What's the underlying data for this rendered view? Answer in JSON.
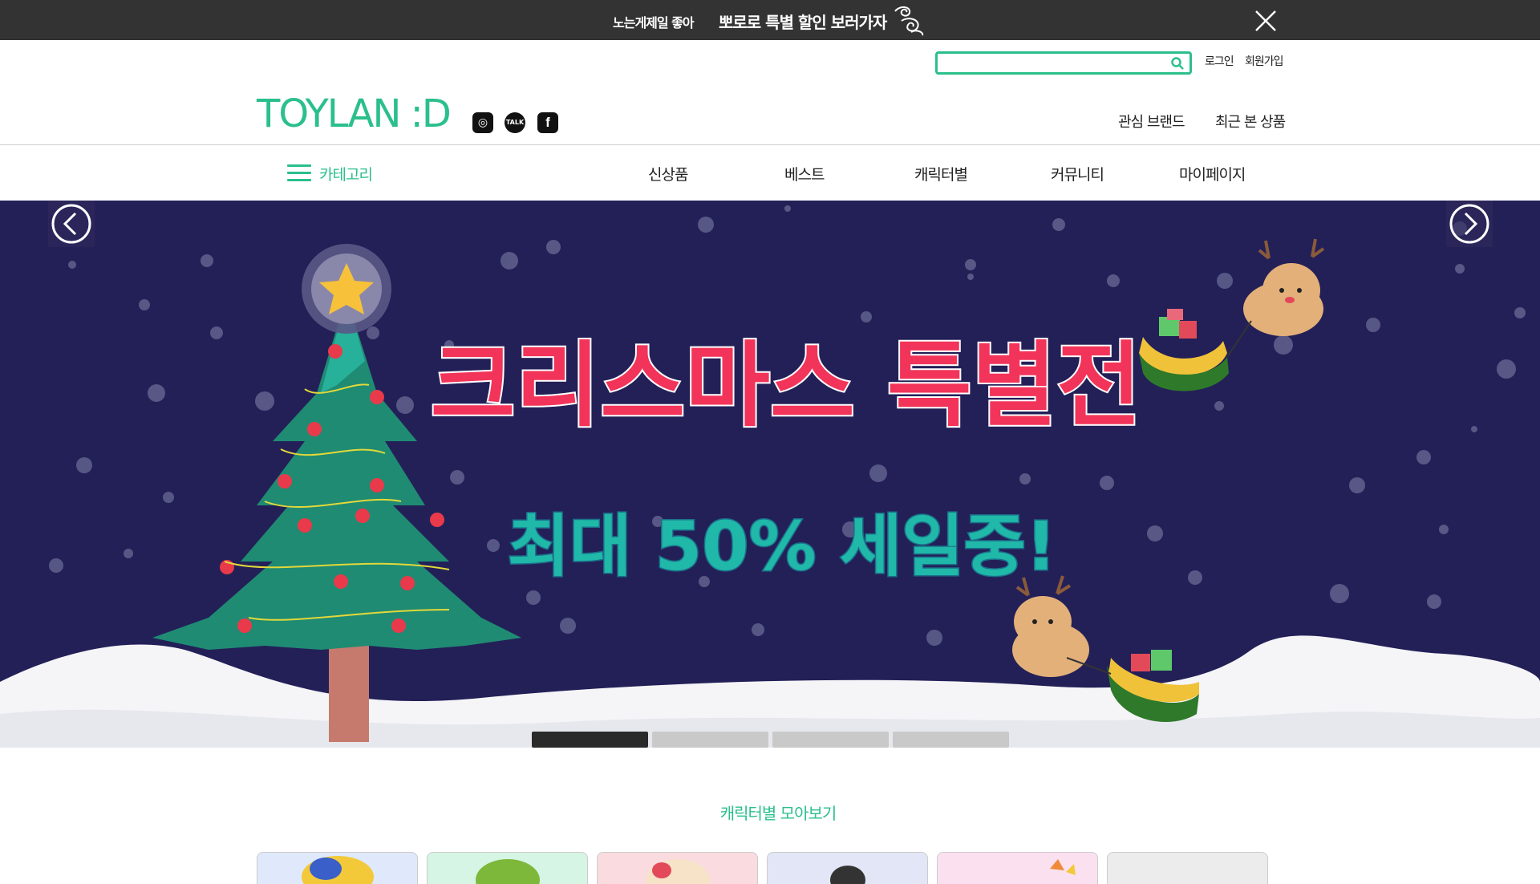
{
  "topbar": {
    "promo_small": "노는게제일 좋아",
    "promo_big": "뽀로로 특별 할인 보러가자"
  },
  "header": {
    "search_placeholder": "",
    "login": "로그인",
    "signup": "회원가입",
    "logo_text": "TOYLAN :D",
    "interest_brand": "관심 브랜드",
    "recent_products": "최근 본 상품",
    "sns": {
      "instagram_glyph": "◎",
      "talk_glyph": "TALK",
      "facebook_glyph": "f"
    }
  },
  "nav": {
    "category_label": "카테고리",
    "items": [
      "신상품",
      "베스트",
      "캐릭터별",
      "커뮤니티",
      "마이페이지"
    ]
  },
  "banner": {
    "headline": "크리스마스 특별전",
    "subline": "최대 50% 세일중!",
    "slides_total": 4,
    "active_slide": 1
  },
  "section": {
    "title": "캐릭터별 모아보기"
  },
  "card_colors": [
    "#dfe9fb",
    "#d6f5e4",
    "#fadbe0",
    "#e2e6f7",
    "#fbe1ef",
    "#ececec"
  ],
  "colors": {
    "accent": "#2bbf8c",
    "topbar_bg": "#333333",
    "banner_bg": "#232058",
    "headline": "#f2345a",
    "subline": "#20b8a8"
  }
}
